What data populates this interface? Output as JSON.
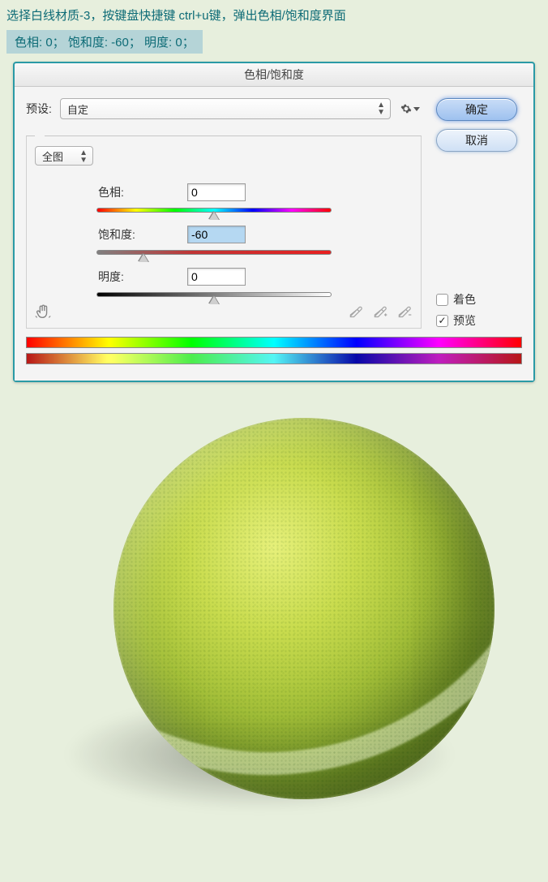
{
  "instruction": {
    "line1": "选择白线材质-3，按键盘快捷键 ctrl+u键，弹出色相/饱和度界面",
    "line2": "色相: 0；   饱和度: -60；    明度: 0；"
  },
  "dialog": {
    "title": "色相/饱和度",
    "preset_label": "预设:",
    "preset_value": "自定",
    "range_value": "全图",
    "hue": {
      "label": "色相:",
      "value": "0",
      "pos_pct": 50
    },
    "sat": {
      "label": "饱和度:",
      "value": "-60",
      "pos_pct": 20
    },
    "lig": {
      "label": "明度:",
      "value": "0",
      "pos_pct": 50
    },
    "ok": "确定",
    "cancel": "取消",
    "colorize_label": "着色",
    "preview_label": "预览",
    "preview_checked": true,
    "colorize_checked": false
  }
}
